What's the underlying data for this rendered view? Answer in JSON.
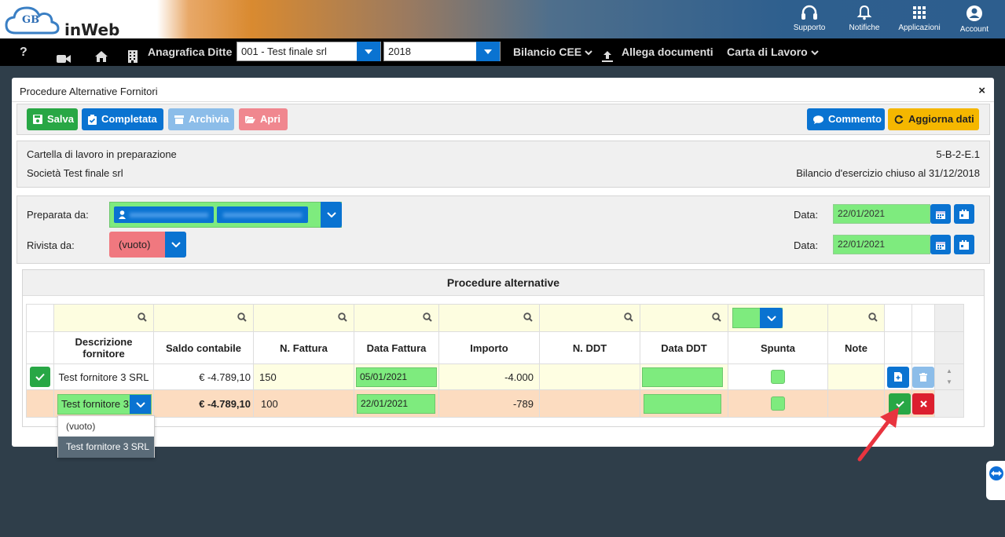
{
  "topbar": {
    "logo_text": "inWeb",
    "logo_badge": "GB",
    "icons": [
      {
        "name": "headset-icon",
        "label": "Supporto"
      },
      {
        "name": "bell-icon",
        "label": "Notifiche"
      },
      {
        "name": "grid-icon",
        "label": "Applicazioni"
      },
      {
        "name": "user-circle-icon",
        "label": "Account"
      }
    ]
  },
  "navbar": {
    "help": "?",
    "anagrafica": "Anagrafica Ditte",
    "company_select": "001 - Test finale srl",
    "year_select": "2018",
    "bilancio": "Bilancio CEE",
    "allega": "Allega documenti",
    "carta": "Carta di Lavoro"
  },
  "modal": {
    "title": "Procedure Alternative Fornitori",
    "close": "×",
    "toolbar": {
      "salva": "Salva",
      "completata": "Completata",
      "archivia": "Archivia",
      "apri": "Apri",
      "commento": "Commento",
      "aggiorna": "Aggiorna dati"
    },
    "info": {
      "status": "Cartella di lavoro in preparazione",
      "code": "5-B-2-E.1",
      "company": "Società Test finale srl",
      "bilancio": "Bilancio d'esercizio chiuso al 31/12/2018"
    },
    "review": {
      "preparata_label": "Preparata da:",
      "rivista_label": "Rivista da:",
      "rivista_value": "(vuoto)",
      "data_label": "Data:",
      "data_preparata": "22/01/2021",
      "data_rivista": "22/01/2021"
    },
    "section_title": "Procedure alternative",
    "columns": [
      "Descrizione fornitore",
      "Saldo contabile",
      "N. Fattura",
      "Data Fattura",
      "Importo",
      "N. DDT",
      "Data DDT",
      "Spunta",
      "Note"
    ],
    "rows": [
      {
        "fornitore": "Test fornitore 3 SRL",
        "saldo": "€ -4.789,10",
        "n_fattura": "150",
        "data_fattura": "05/01/2021",
        "importo": "-4.000"
      },
      {
        "fornitore": "Test fornitore 3 SRL",
        "saldo": "€ -4.789,10",
        "n_fattura": "100",
        "data_fattura": "22/01/2021",
        "importo": "-789"
      }
    ],
    "dropdown_options": [
      "(vuoto)",
      "Test fornitore 3 SRL"
    ]
  },
  "colors": {
    "primary": "#0a73d1",
    "success": "#28a745",
    "danger": "#dc1f2e",
    "warning": "#f5b700",
    "field_green": "#7eeb7e"
  }
}
